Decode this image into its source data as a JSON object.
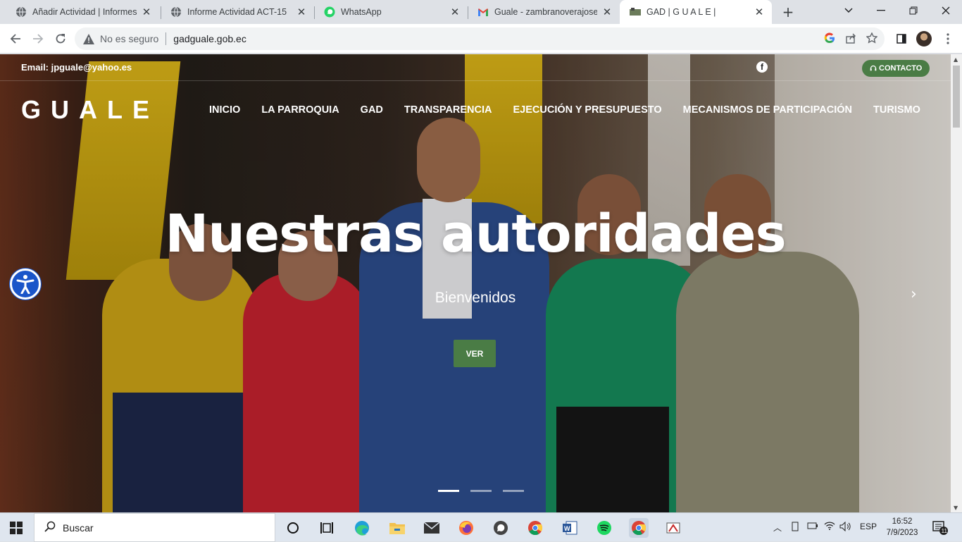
{
  "browser": {
    "tabs": [
      {
        "title": "Añadir Actividad | Informes M",
        "active": false,
        "icon": "globe-icon"
      },
      {
        "title": "Informe Actividad ACT-15",
        "active": false,
        "icon": "globe-icon"
      },
      {
        "title": "WhatsApp",
        "active": false,
        "icon": "whatsapp-icon"
      },
      {
        "title": "Guale - zambranoverajosear",
        "active": false,
        "icon": "gmail-icon"
      },
      {
        "title": "GAD | G U A L E |",
        "active": true,
        "icon": "site-icon"
      }
    ],
    "security_label": "No es seguro",
    "url": "gadguale.gob.ec"
  },
  "site": {
    "email": "Email: jpguale@yahoo.es",
    "contact_label": "CONTACTO",
    "logo": "GUALE",
    "nav": [
      "INICIO",
      "LA PARROQUIA",
      "GAD",
      "TRANSPARENCIA",
      "EJECUCIÓN Y PRESUPUESTO",
      "MECANISMOS DE PARTICIPACIÓN",
      "TURISMO"
    ],
    "hero": {
      "title": "Nuestras autoridades",
      "subtitle": "Bienvenidos",
      "button": "VER",
      "slides": 3,
      "active_slide": 1
    },
    "colors": {
      "accent_green": "#4a7c45",
      "accessibility_blue": "#1a55c9"
    }
  },
  "taskbar": {
    "search_placeholder": "Buscar",
    "language": "ESP",
    "time": "16:52",
    "date": "7/9/2023",
    "notification_count": "11"
  }
}
